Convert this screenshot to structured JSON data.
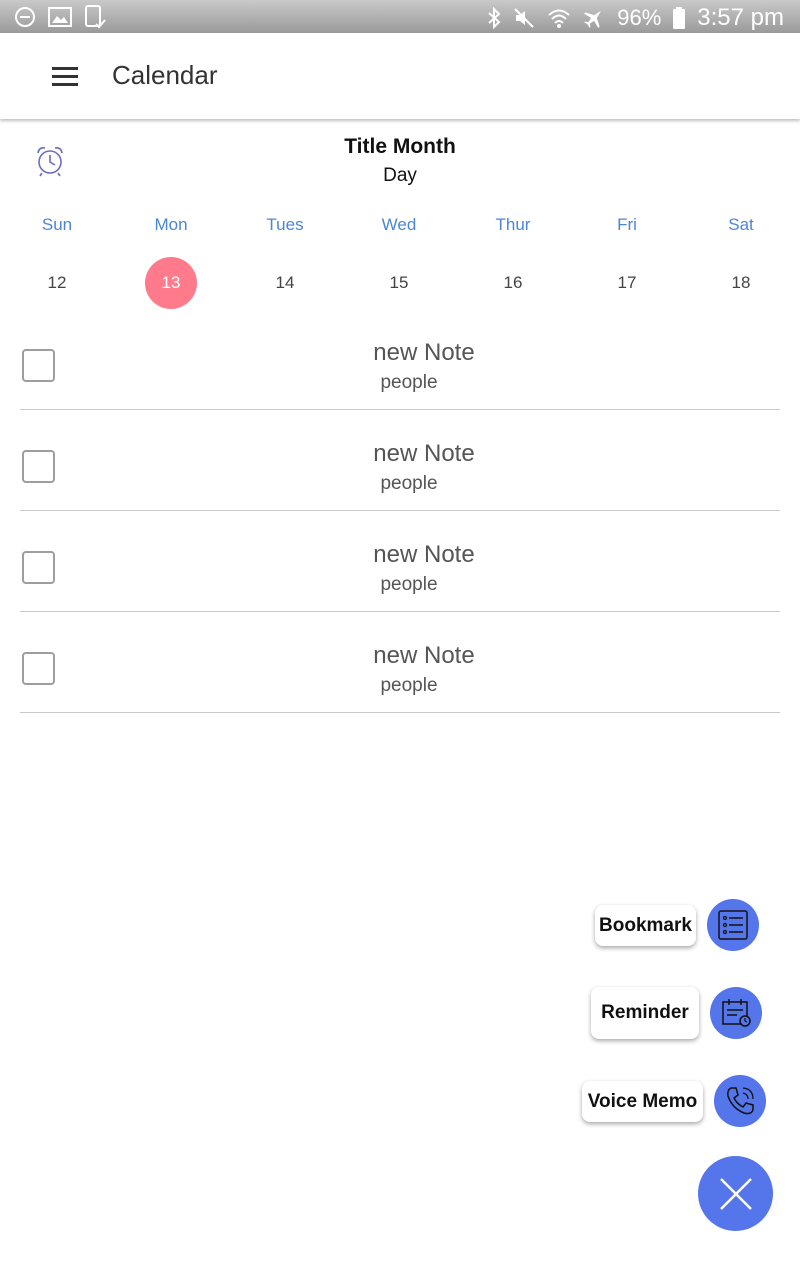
{
  "status_bar": {
    "battery": "96%",
    "time": "3:57 pm",
    "icons": [
      "do-not-disturb-icon",
      "image-icon",
      "tablet-check-icon",
      "bluetooth-icon",
      "mute-icon",
      "wifi-icon",
      "airplane-icon",
      "battery-icon"
    ]
  },
  "app_bar": {
    "title": "Calendar",
    "menu_icon": "hamburger-menu-icon"
  },
  "header": {
    "month_title": "Title Month",
    "day_title": "Day",
    "alarm_icon": "alarm-clock-icon"
  },
  "week": {
    "days": [
      "Sun",
      "Mon",
      "Tues",
      "Wed",
      "Thur",
      "Fri",
      "Sat"
    ],
    "dates": [
      "12",
      "13",
      "14",
      "15",
      "16",
      "17",
      "18"
    ],
    "selected_date": "13"
  },
  "notes": [
    {
      "title": "new Note",
      "subtitle": "people"
    },
    {
      "title": "new Note",
      "subtitle": "people"
    },
    {
      "title": "new Note",
      "subtitle": "people"
    },
    {
      "title": "new Note",
      "subtitle": "people"
    }
  ],
  "fab_menu": {
    "items": [
      {
        "label": "Bookmark",
        "icon": "list-icon"
      },
      {
        "label": "Reminder",
        "icon": "calendar-alarm-icon"
      },
      {
        "label": "Voice Memo",
        "icon": "phone-call-icon"
      }
    ],
    "close_icon": "close-icon"
  },
  "colors": {
    "accent": "#5575ea",
    "selected_date": "#ff7a8a",
    "weekday": "#4a86d6"
  }
}
